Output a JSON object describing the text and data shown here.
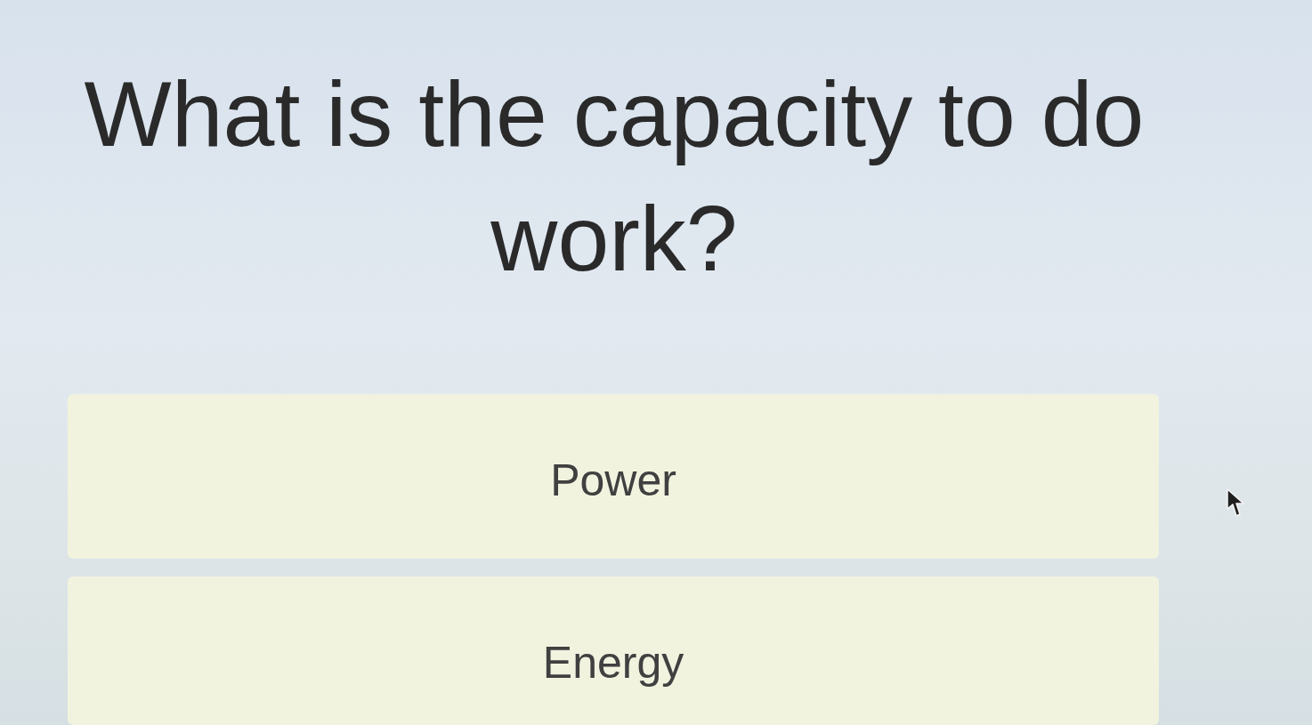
{
  "question": "What is the capacity to do work?",
  "options": [
    {
      "label": "Power"
    },
    {
      "label": "Energy"
    }
  ]
}
